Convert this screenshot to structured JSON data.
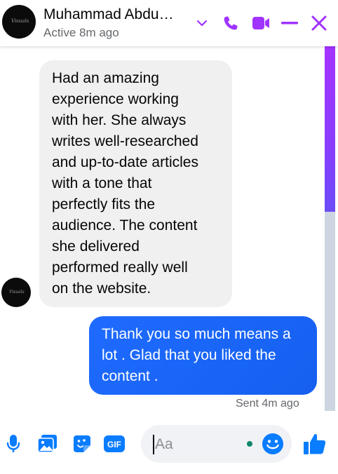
{
  "header": {
    "contact_name": "Muhammad Abdu…",
    "status": "Active 8m ago",
    "avatar_text": "Visuals"
  },
  "messages": [
    {
      "direction": "incoming",
      "lines": [
        "Had an amazing",
        "experience working",
        "with her. She always",
        "writes well-researched",
        "and up-to-date articles",
        "with a tone that",
        "perfectly fits the",
        "audience. The content",
        "she delivered",
        "performed really well",
        "on the website."
      ]
    },
    {
      "direction": "outgoing",
      "lines": [
        "Thank you so much means a",
        "lot . Glad that you liked the",
        "content ."
      ],
      "status": "Sent 4m ago"
    }
  ],
  "composer": {
    "placeholder": "Aa",
    "gif_label": "GIF"
  },
  "icons": {
    "header": [
      "chevron-down-icon",
      "phone-icon",
      "video-icon",
      "minimize-icon",
      "close-icon"
    ],
    "composer": [
      "microphone-icon",
      "image-icon",
      "sticker-icon",
      "gif-icon",
      "emoji-icon",
      "like-icon"
    ]
  },
  "colors": {
    "accent": "#a033ff",
    "composer_blue": "#0a7cff",
    "outgoing_bubble": "#1a66ff",
    "incoming_bubble": "#f0f0f0",
    "online": "#10876d"
  }
}
